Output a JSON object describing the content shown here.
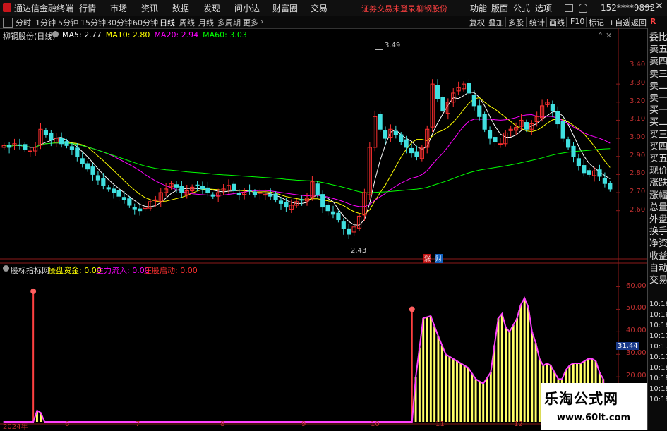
{
  "titlebar": {
    "app_name": "通达信金融终端",
    "menu": [
      "行情",
      "市场",
      "资讯",
      "数据",
      "发现",
      "问小达",
      "财富圈",
      "交易"
    ],
    "warning": "证券交易未登录",
    "stock": "柳钢股份",
    "right_menu": [
      "功能",
      "版面",
      "公式",
      "选项"
    ],
    "user": "152****9892"
  },
  "toolbar": {
    "periods": [
      "分时",
      "1分钟",
      "5分钟",
      "15分钟",
      "30分钟",
      "60分钟",
      "日线",
      "周线",
      "月线",
      "多周期",
      "更多"
    ],
    "active_period": "日线",
    "tools": [
      "复权",
      "叠加",
      "多股",
      "统计",
      "画线",
      "F10",
      "标记",
      "+自选",
      "返回"
    ]
  },
  "main_chart": {
    "title": "柳钢股份(日线)",
    "ma_labels": [
      {
        "text": "MA5: 2.77",
        "color": "#ffffff"
      },
      {
        "text": "MA10: 2.80",
        "color": "#ffff00"
      },
      {
        "text": "MA20: 2.94",
        "color": "#ff00ff"
      },
      {
        "text": "MA60: 3.03",
        "color": "#00ff00"
      }
    ],
    "high_label": "3.49",
    "low_label": "2.43",
    "badge_zhang": "涨",
    "badge_cai": "财",
    "y_ticks": [
      "3.40",
      "3.30",
      "3.20",
      "3.10",
      "3.00",
      "2.90",
      "2.80",
      "2.70",
      "2.60"
    ]
  },
  "indicator": {
    "name": "股标指标网",
    "caopan_label": "操盘资金: 0.00",
    "zhuli_label": "主力流入: 0.00",
    "zhuang_label": "庄股启动: 0.00",
    "y_ticks": [
      "60.00",
      "50.00",
      "40.00",
      "30.00",
      "20.00"
    ],
    "current_value": "31.44"
  },
  "x_axis": [
    "2024年",
    "6",
    "7",
    "8",
    "9",
    "10",
    "11",
    "12"
  ],
  "right_panel": {
    "items": [
      "委比",
      "卖五",
      "卖四",
      "卖三",
      "卖二",
      "卖一",
      "买一",
      "买二",
      "买三",
      "买四",
      "买五",
      "现价",
      "涨跌",
      "涨幅",
      "总量",
      "外盘",
      "换手",
      "净资",
      "收益",
      "自动",
      "交易"
    ],
    "times": [
      "10:16",
      "10:16",
      "10:16",
      "10:17",
      "10:17",
      "10:17",
      "10:18",
      "10:18",
      "10:18",
      "10:18"
    ]
  },
  "watermark": {
    "line1": "乐淘公式网",
    "line2": "www.60lt.com"
  },
  "chart_data": {
    "type": "candlestick",
    "title": "柳钢股份(日线)",
    "ylim": [
      2.4,
      3.55
    ],
    "candles_close_approx": [
      2.96,
      2.95,
      2.97,
      2.96,
      2.94,
      2.93,
      2.95,
      3.05,
      3.02,
      2.99,
      3.0,
      2.97,
      2.96,
      2.94,
      2.9,
      2.86,
      2.83,
      2.8,
      2.77,
      2.74,
      2.72,
      2.7,
      2.68,
      2.66,
      2.63,
      2.61,
      2.6,
      2.62,
      2.65,
      2.66,
      2.7,
      2.72,
      2.75,
      2.73,
      2.7,
      2.71,
      2.73,
      2.74,
      2.72,
      2.7,
      2.68,
      2.7,
      2.72,
      2.74,
      2.71,
      2.69,
      2.7,
      2.71,
      2.69,
      2.7,
      2.69,
      2.68,
      2.66,
      2.64,
      2.62,
      2.63,
      2.65,
      2.66,
      2.67,
      2.76,
      2.69,
      2.62,
      2.6,
      2.58,
      2.55,
      2.5,
      2.47,
      2.51,
      2.57,
      2.7,
      2.95,
      3.12,
      3.05,
      3.0,
      3.05,
      3.02,
      2.98,
      2.95,
      2.92,
      2.9,
      2.95,
      3.05,
      3.3,
      3.22,
      3.15,
      3.2,
      3.25,
      3.28,
      3.3,
      3.25,
      3.18,
      3.12,
      3.05,
      3.0,
      2.98,
      2.97,
      3.03,
      3.05,
      3.06,
      3.1,
      3.05,
      3.08,
      3.12,
      3.18,
      3.2,
      3.15,
      3.08,
      3.0,
      2.95,
      2.9,
      2.85,
      2.81,
      2.8,
      2.82,
      2.79,
      2.75,
      2.72
    ],
    "series": [
      {
        "name": "MA5",
        "color": "#ffffff"
      },
      {
        "name": "MA10",
        "color": "#ffff00"
      },
      {
        "name": "MA20",
        "color": "#ff00ff"
      },
      {
        "name": "MA60",
        "color": "#00ff00"
      }
    ],
    "indicator_series": {
      "name": "操盘资金",
      "ylim": [
        0,
        68
      ],
      "spikes": [
        {
          "index": 8,
          "value": 58
        },
        {
          "index": 109,
          "value": 50
        }
      ],
      "profile": [
        [
          0,
          0
        ],
        [
          8,
          0
        ],
        [
          9,
          5
        ],
        [
          10,
          4
        ],
        [
          11,
          0
        ],
        [
          109,
          0
        ],
        [
          110,
          20
        ],
        [
          112,
          46
        ],
        [
          114,
          47
        ],
        [
          116,
          38
        ],
        [
          118,
          30
        ],
        [
          120,
          28
        ],
        [
          122,
          26
        ],
        [
          124,
          24
        ],
        [
          126,
          19
        ],
        [
          128,
          17
        ],
        [
          130,
          22
        ],
        [
          131,
          34
        ],
        [
          132,
          46
        ],
        [
          133,
          48
        ],
        [
          134,
          42
        ],
        [
          135,
          40
        ],
        [
          136,
          43
        ],
        [
          137,
          46
        ],
        [
          138,
          52
        ],
        [
          139,
          55
        ],
        [
          140,
          51
        ],
        [
          141,
          40
        ],
        [
          142,
          35
        ],
        [
          143,
          28
        ],
        [
          144,
          25
        ],
        [
          145,
          26
        ],
        [
          146,
          25
        ],
        [
          147,
          22
        ],
        [
          148,
          19
        ],
        [
          149,
          19
        ],
        [
          150,
          23
        ],
        [
          151,
          25
        ],
        [
          152,
          26
        ],
        [
          153,
          26
        ],
        [
          154,
          26
        ],
        [
          155,
          27
        ],
        [
          156,
          28
        ],
        [
          157,
          28
        ],
        [
          158,
          27
        ],
        [
          159,
          22
        ],
        [
          160,
          19
        ]
      ]
    }
  }
}
